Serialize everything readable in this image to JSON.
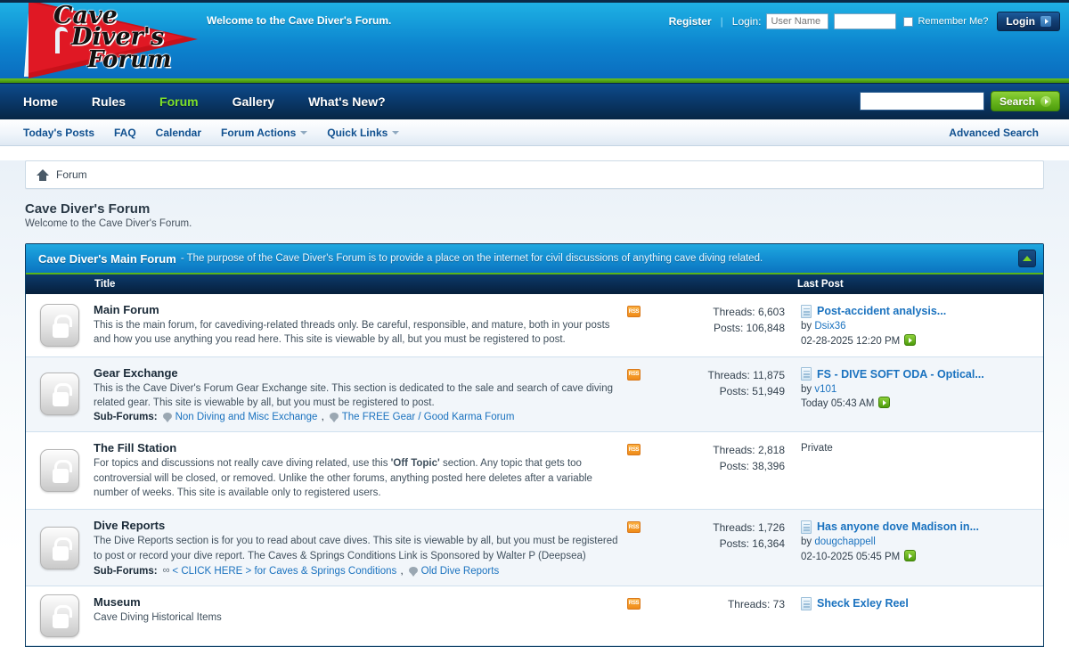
{
  "header": {
    "logo_lines": [
      "Cave",
      "Diver's",
      "Forum"
    ],
    "welcome": "Welcome to the Cave Diver's Forum.",
    "register_label": "Register",
    "separator": "|",
    "login_label": "Login:",
    "username_placeholder": "User Name",
    "username_value": "",
    "password_value": "",
    "remember_label": "Remember Me?",
    "login_button": "Login"
  },
  "nav": {
    "items": [
      {
        "label": "Home",
        "active": false
      },
      {
        "label": "Rules",
        "active": false
      },
      {
        "label": "Forum",
        "active": true
      },
      {
        "label": "Gallery",
        "active": false
      },
      {
        "label": "What's New?",
        "active": false
      }
    ],
    "search_value": "",
    "search_button": "Search"
  },
  "subnav": {
    "items": [
      {
        "label": "Today's Posts",
        "caret": false
      },
      {
        "label": "FAQ",
        "caret": false
      },
      {
        "label": "Calendar",
        "caret": false
      },
      {
        "label": "Forum Actions",
        "caret": true
      },
      {
        "label": "Quick Links",
        "caret": true
      }
    ],
    "advanced_search": "Advanced Search"
  },
  "breadcrumb": {
    "home": "Forum"
  },
  "page": {
    "title": "Cave Diver's Forum",
    "subtitle": "Welcome to the Cave Diver's Forum."
  },
  "category": {
    "title": "Cave Diver's Main Forum",
    "description": "- The purpose of the Cave Diver's Forum is to provide a place on the internet for civil discussions of anything cave diving related.",
    "columns": {
      "title": "Title",
      "last_post": "Last Post"
    }
  },
  "forums": [
    {
      "name": "Main Forum",
      "description": "This is the main forum, for cavediving-related threads only. Be careful, responsible, and mature, both in your posts and how you use anything you read here. This site is viewable by all, but you must be registered to post.",
      "subforums_label": "",
      "subforums": [],
      "rss": "RSS",
      "threads": "Threads: 6,603",
      "posts": "Posts: 106,848",
      "last_post": {
        "title": "Post-accident analysis...",
        "by_label": "by",
        "author": "Dsix36",
        "date": "02-28-2025 12:20 PM",
        "private": false
      }
    },
    {
      "name": "Gear Exchange",
      "description": "This is the Cave Diver's Forum Gear Exchange site. This section is dedicated to the sale and search of cave diving related gear. This site is viewable by all, but you must be registered to post.",
      "subforums_label": "Sub-Forums:",
      "subforums": [
        {
          "label": "Non Diving and Misc Exchange",
          "icon": "speech-bubble-icon"
        },
        {
          "label": "The FREE Gear / Good Karma Forum",
          "icon": "speech-bubble-icon"
        }
      ],
      "rss": "RSS",
      "threads": "Threads: 11,875",
      "posts": "Posts: 51,949",
      "last_post": {
        "title": "FS - DIVE SOFT ODA - Optical...",
        "by_label": "by",
        "author": "v101",
        "date": "Today 05:43 AM",
        "private": false
      }
    },
    {
      "name": "The Fill Station",
      "description": "For topics and discussions not really cave diving related, use this 'Off Topic' section. Any topic that gets too controversial will be closed, or removed. Unlike the other forums, anything posted here deletes after a variable number of weeks. This site is available only to registered users.",
      "description_bold": "'Off Topic'",
      "subforums_label": "",
      "subforums": [],
      "rss": "RSS",
      "threads": "Threads: 2,818",
      "posts": "Posts: 38,396",
      "last_post": {
        "title": "",
        "by_label": "",
        "author": "",
        "date": "",
        "private": true,
        "private_label": "Private"
      }
    },
    {
      "name": "Dive Reports",
      "description": "The Dive Reports section is for you to read about cave dives. This site is viewable by all, but you must be registered to post or record your dive report. The Caves & Springs Conditions Link is Sponsored by Walter P (Deepsea)",
      "subforums_label": "Sub-Forums:",
      "subforums": [
        {
          "label": "< CLICK HERE > for Caves & Springs Conditions",
          "icon": "chain-link-icon"
        },
        {
          "label": "Old Dive Reports",
          "icon": "speech-bubble-icon"
        }
      ],
      "rss": "RSS",
      "threads": "Threads: 1,726",
      "posts": "Posts: 16,364",
      "last_post": {
        "title": "Has anyone dove Madison in...",
        "by_label": "by",
        "author": "dougchappell",
        "date": "02-10-2025 05:45 PM",
        "private": false
      }
    },
    {
      "name": "Museum",
      "description": "Cave Diving Historical Items",
      "subforums_label": "",
      "subforums": [],
      "rss": "RSS",
      "threads": "Threads: 73",
      "posts": "",
      "last_post": {
        "title": "Sheck Exley Reel",
        "by_label": "",
        "author": "",
        "date": "",
        "private": false
      }
    }
  ],
  "colors": {
    "header_top": "#1fb0e4",
    "header_bottom": "#0a6cbf",
    "green_bar": "#6cc022",
    "nav_dark": "#0a3a6d",
    "link_blue": "#1a72bf",
    "active_green": "#7ee02a",
    "rss_orange": "#ef8b19"
  }
}
